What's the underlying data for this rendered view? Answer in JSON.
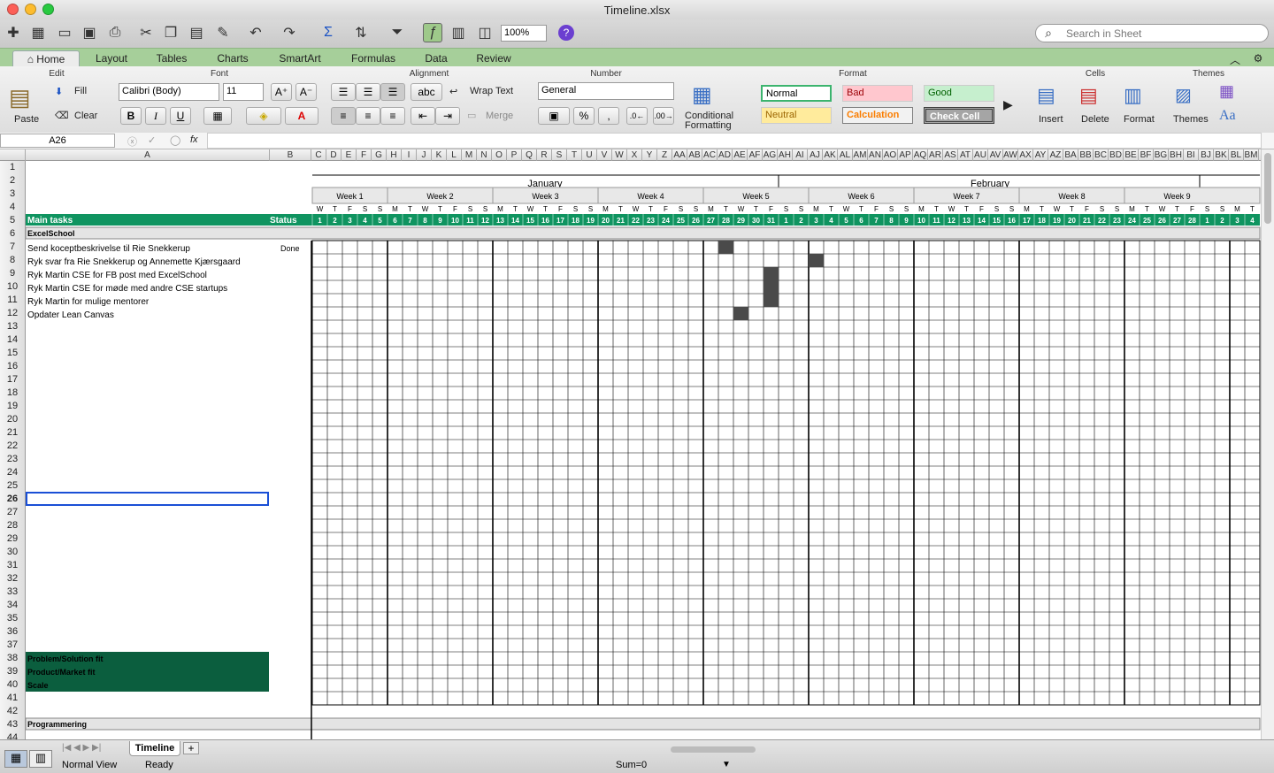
{
  "window": {
    "title": "Timeline.xlsx"
  },
  "toolbar": {
    "zoom": "100%",
    "search_placeholder": "Search in Sheet"
  },
  "ribbon_tabs": [
    "Home",
    "Layout",
    "Tables",
    "Charts",
    "SmartArt",
    "Formulas",
    "Data",
    "Review"
  ],
  "ribbon": {
    "groups": {
      "edit": "Edit",
      "font": "Font",
      "alignment": "Alignment",
      "number": "Number",
      "format": "Format",
      "cells": "Cells",
      "themes": "Themes"
    },
    "paste": "Paste",
    "fill": "Fill",
    "clear": "Clear",
    "font_name": "Calibri (Body)",
    "font_size": "11",
    "bold": "B",
    "italic": "I",
    "underline": "U",
    "wrap_text": "Wrap Text",
    "merge": "Merge",
    "abc": "abc",
    "number_format": "General",
    "percent": "%",
    "comma": ",",
    "conditional": "Conditional",
    "formatting": "Formatting",
    "styles": {
      "normal": "Normal",
      "bad": "Bad",
      "good": "Good",
      "neutral": "Neutral",
      "calculation": "Calculation",
      "check_cell": "Check Cell"
    },
    "insert": "Insert",
    "delete": "Delete",
    "format_btn": "Format",
    "themes_btn": "Themes",
    "aa": "Aa"
  },
  "formula_bar": {
    "name_box": "A26",
    "fx": "fx",
    "formula": ""
  },
  "column_headers": [
    "A",
    "B",
    "C",
    "D",
    "E",
    "F",
    "G",
    "H",
    "I",
    "J",
    "K",
    "L",
    "M",
    "N",
    "O",
    "P",
    "Q",
    "R",
    "S",
    "T",
    "U",
    "V",
    "W",
    "X",
    "Y",
    "Z",
    "AA",
    "AB",
    "AC",
    "AD",
    "AE",
    "AF",
    "AG",
    "AH",
    "AI",
    "AJ",
    "AK",
    "AL",
    "AM",
    "AN",
    "AO",
    "AP",
    "AQ",
    "AR",
    "AS",
    "AT",
    "AU",
    "AV",
    "AW",
    "AX",
    "AY",
    "AZ",
    "BA",
    "BB",
    "BC",
    "BD",
    "BE",
    "BF",
    "BG",
    "BH",
    "BI",
    "BJ",
    "BK",
    "BL",
    "BM"
  ],
  "row_headers": [
    "1",
    "2",
    "3",
    "4",
    "5",
    "6",
    "7",
    "8",
    "9",
    "10",
    "11",
    "12",
    "13",
    "14",
    "15",
    "16",
    "17",
    "18",
    "19",
    "20",
    "21",
    "22",
    "23",
    "24",
    "25",
    "26",
    "27",
    "28",
    "29",
    "30",
    "31",
    "32",
    "33",
    "34",
    "35",
    "36",
    "37",
    "38",
    "39",
    "40",
    "41",
    "42",
    "43",
    "44"
  ],
  "timeline": {
    "months": [
      "January",
      "February"
    ],
    "weeks": [
      "Week 1",
      "Week 2",
      "Week 3",
      "Week 4",
      "Week 5",
      "Week 6",
      "Week 7",
      "Week 8",
      "Week 9"
    ],
    "weekdays": [
      "W",
      "T",
      "F",
      "S",
      "S",
      "M",
      "T",
      "W",
      "T",
      "F",
      "S",
      "S",
      "M",
      "T",
      "W",
      "T",
      "F",
      "S",
      "S",
      "M",
      "T",
      "W",
      "T",
      "F",
      "S",
      "S",
      "M",
      "T",
      "W",
      "T",
      "F",
      "S",
      "S",
      "M",
      "T",
      "W",
      "T",
      "F",
      "S",
      "S",
      "M",
      "T",
      "W",
      "T",
      "F",
      "S",
      "S",
      "M",
      "T",
      "W",
      "T",
      "F",
      "S",
      "S",
      "M",
      "T",
      "W",
      "T",
      "F",
      "S",
      "S",
      "M",
      "T"
    ],
    "dates": [
      "1",
      "2",
      "3",
      "4",
      "5",
      "6",
      "7",
      "8",
      "9",
      "10",
      "11",
      "12",
      "13",
      "14",
      "15",
      "16",
      "17",
      "18",
      "19",
      "20",
      "21",
      "22",
      "23",
      "24",
      "25",
      "26",
      "27",
      "28",
      "29",
      "30",
      "31",
      "1",
      "2",
      "3",
      "4",
      "5",
      "6",
      "7",
      "8",
      "9",
      "10",
      "11",
      "12",
      "13",
      "14",
      "15",
      "16",
      "17",
      "18",
      "19",
      "20",
      "21",
      "22",
      "23",
      "24",
      "25",
      "26",
      "27",
      "28",
      "1",
      "2",
      "3",
      "4"
    ]
  },
  "header_row": {
    "main_tasks": "Main tasks",
    "status": "Status"
  },
  "section1": "ExcelSchool",
  "tasks": [
    {
      "name": "Send koceptbeskrivelse til Rie Snekkerup",
      "status": "Done",
      "filled_days": [
        27
      ]
    },
    {
      "name": "Ryk svar fra Rie Snekkerup og Annemette Kjærsgaard",
      "status": "",
      "filled_days": [
        33
      ]
    },
    {
      "name": "Ryk Martin CSE for FB post med ExcelSchool",
      "status": "",
      "filled_days": [
        30
      ]
    },
    {
      "name": "Ryk Martin CSE for møde med andre CSE startups",
      "status": "",
      "filled_days": [
        30
      ]
    },
    {
      "name": "Ryk Martin for mulige mentorer",
      "status": "",
      "filled_days": [
        30
      ]
    },
    {
      "name": "Opdater Lean Canvas",
      "status": "",
      "filled_days": [
        28
      ]
    }
  ],
  "milestones": [
    "Problem/Solution fit",
    "Product/Market fit",
    "Scale"
  ],
  "section2": "Programmering",
  "sheet_tab": "Timeline",
  "status": {
    "view": "Normal View",
    "state": "Ready",
    "sum": "Sum=0"
  }
}
